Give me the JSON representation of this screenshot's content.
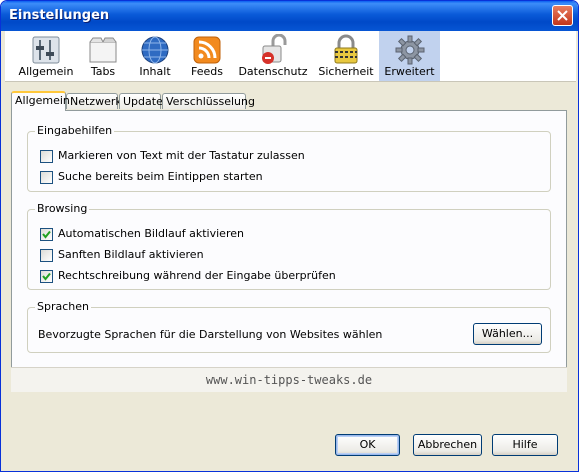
{
  "window": {
    "title": "Einstellungen",
    "close_label": "close"
  },
  "toolbar": {
    "items": [
      {
        "label": "Allgemein",
        "icon": "general-settings-icon"
      },
      {
        "label": "Tabs",
        "icon": "tabs-icon"
      },
      {
        "label": "Inhalt",
        "icon": "globe-icon"
      },
      {
        "label": "Feeds",
        "icon": "rss-feed-icon"
      },
      {
        "label": "Datenschutz",
        "icon": "privacy-icon"
      },
      {
        "label": "Sicherheit",
        "icon": "padlock-icon"
      },
      {
        "label": "Erweitert",
        "icon": "gear-icon",
        "active": true
      }
    ]
  },
  "subtabs": {
    "items": [
      {
        "label": "Allgemein",
        "active": true
      },
      {
        "label": "Netzwerk"
      },
      {
        "label": "Update"
      },
      {
        "label": "Verschlüsselung"
      }
    ]
  },
  "groups": {
    "eingabehilfen": {
      "title": "Eingabehilfen",
      "options": [
        {
          "label": "Markieren von Text mit der Tastatur zulassen",
          "checked": false
        },
        {
          "label": "Suche bereits beim Eintippen starten",
          "checked": false
        }
      ]
    },
    "browsing": {
      "title": "Browsing",
      "options": [
        {
          "label": "Automatischen Bildlauf aktivieren",
          "checked": true
        },
        {
          "label": "Sanften Bildlauf aktivieren",
          "checked": false
        },
        {
          "label": "Rechtschreibung während der Eingabe überprüfen",
          "checked": true
        }
      ]
    },
    "sprachen": {
      "title": "Sprachen",
      "description": "Bevorzugte Sprachen für die Darstellung von Websites wählen",
      "button_label": "Wählen..."
    }
  },
  "watermark": "www.win-tipps-tweaks.de",
  "buttons": {
    "ok": "OK",
    "cancel": "Abbrechen",
    "help": "Hilfe"
  },
  "colors": {
    "titlebar": "#0a5ad8",
    "dialog_bg": "#ece9d8",
    "active_tab_accent": "#ffc83c",
    "checkmark": "#21a121"
  }
}
